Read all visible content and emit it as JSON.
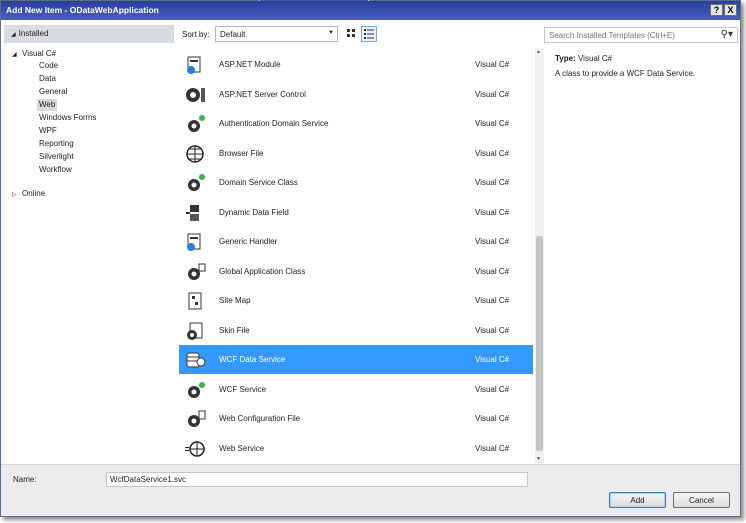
{
  "window": {
    "title": "Add New Item - ODataWebApplication",
    "help_label": "?",
    "close_label": "X"
  },
  "sidebar": {
    "installed_label": "Installed",
    "tree": {
      "root": "Visual C#",
      "children": [
        "Code",
        "Data",
        "General",
        "Web",
        "Windows Forms",
        "WPF",
        "Reporting",
        "Silverlight",
        "Workflow"
      ],
      "selected": "Web",
      "online": "Online"
    }
  },
  "toolbar": {
    "sort_label": "Sort by:",
    "sort_value": "Default",
    "search_placeholder": "Search Installed Templates (Ctrl+E)"
  },
  "templates": [
    {
      "name": "ASP.NET Module",
      "lang": "Visual C#",
      "icon": "module-icon"
    },
    {
      "name": "ASP.NET Server Control",
      "lang": "Visual C#",
      "icon": "server-control-icon"
    },
    {
      "name": "Authentication Domain Service",
      "lang": "Visual C#",
      "icon": "domain-service-icon"
    },
    {
      "name": "Browser File",
      "lang": "Visual C#",
      "icon": "browser-file-icon"
    },
    {
      "name": "Domain Service Class",
      "lang": "Visual C#",
      "icon": "domain-service-icon"
    },
    {
      "name": "Dynamic Data Field",
      "lang": "Visual C#",
      "icon": "dynamic-data-icon"
    },
    {
      "name": "Generic Handler",
      "lang": "Visual C#",
      "icon": "handler-icon"
    },
    {
      "name": "Global Application Class",
      "lang": "Visual C#",
      "icon": "global-app-icon"
    },
    {
      "name": "Site Map",
      "lang": "Visual C#",
      "icon": "sitemap-icon"
    },
    {
      "name": "Skin File",
      "lang": "Visual C#",
      "icon": "skin-file-icon"
    },
    {
      "name": "WCF Data Service",
      "lang": "Visual C#",
      "icon": "data-service-icon"
    },
    {
      "name": "WCF Service",
      "lang": "Visual C#",
      "icon": "wcf-service-icon"
    },
    {
      "name": "Web Configuration File",
      "lang": "Visual C#",
      "icon": "config-file-icon"
    },
    {
      "name": "Web Service",
      "lang": "Visual C#",
      "icon": "web-service-icon"
    }
  ],
  "selected_index": 10,
  "info": {
    "type_label": "Type:",
    "type_value": "Visual C#",
    "description": "A class to provide a WCF Data Service."
  },
  "footer": {
    "name_label": "Name:",
    "name_value": "WcfDataService1.svc",
    "add_label": "Add",
    "cancel_label": "Cancel"
  },
  "colors": {
    "selection": "#3399ff",
    "titlebar": "#2a3e9c"
  }
}
